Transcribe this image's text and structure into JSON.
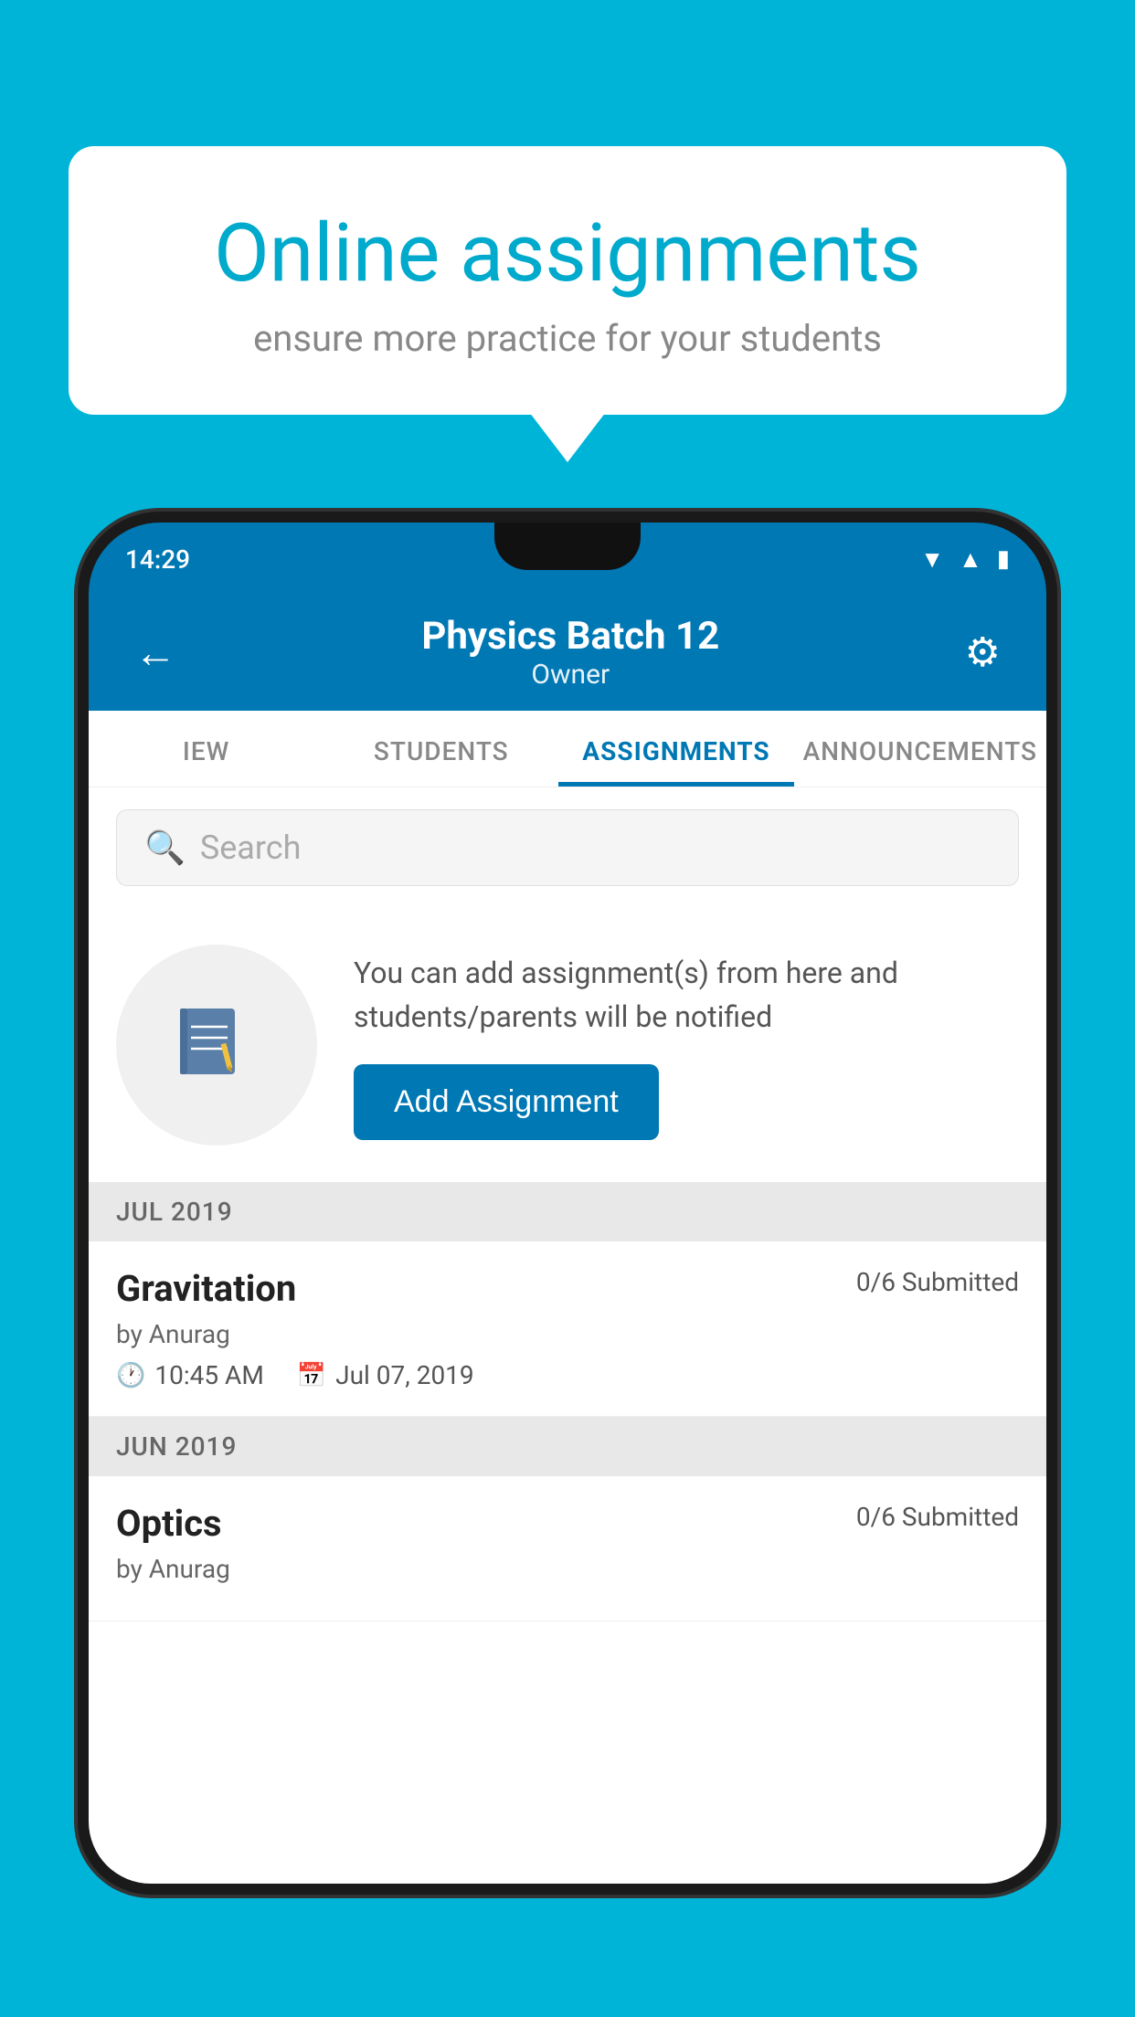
{
  "background_color": "#00B4D8",
  "speech_bubble": {
    "title": "Online assignments",
    "subtitle": "ensure more practice for your students"
  },
  "phone": {
    "status_bar": {
      "time": "14:29",
      "icons": [
        "wifi",
        "signal",
        "battery"
      ]
    },
    "header": {
      "title": "Physics Batch 12",
      "subtitle": "Owner",
      "back_label": "←",
      "settings_label": "⚙"
    },
    "tabs": [
      {
        "label": "IEW",
        "active": false
      },
      {
        "label": "STUDENTS",
        "active": false
      },
      {
        "label": "ASSIGNMENTS",
        "active": true
      },
      {
        "label": "ANNOUNCEMENTS",
        "active": false
      }
    ],
    "search": {
      "placeholder": "Search"
    },
    "add_assignment_section": {
      "description": "You can add assignment(s) from here and students/parents will be notified",
      "button_label": "Add Assignment"
    },
    "assignments": [
      {
        "month": "JUL 2019",
        "items": [
          {
            "name": "Gravitation",
            "submitted": "0/6 Submitted",
            "by": "by Anurag",
            "time": "10:45 AM",
            "date": "Jul 07, 2019"
          }
        ]
      },
      {
        "month": "JUN 2019",
        "items": [
          {
            "name": "Optics",
            "submitted": "0/6 Submitted",
            "by": "by Anurag",
            "time": "",
            "date": ""
          }
        ]
      }
    ]
  }
}
